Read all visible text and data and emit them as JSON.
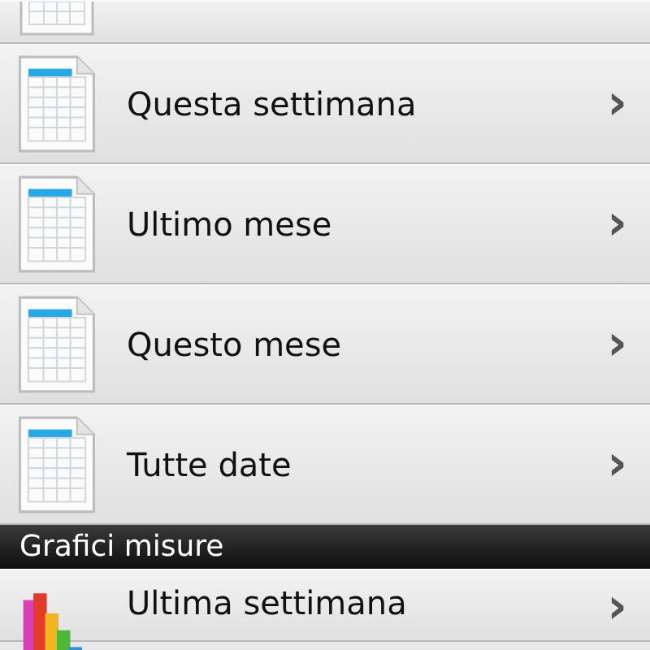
{
  "sections": [
    {
      "items": [
        {
          "kind": "sheet"
        },
        {
          "kind": "sheet",
          "label": "Questa settimana",
          "chevron": "›"
        },
        {
          "kind": "sheet",
          "label": "Ultimo mese",
          "chevron": "›"
        },
        {
          "kind": "sheet",
          "label": "Questo mese",
          "chevron": "›"
        },
        {
          "kind": "sheet",
          "label": "Tutte date",
          "chevron": "›"
        }
      ]
    },
    {
      "header": "Grafici misure",
      "items": [
        {
          "kind": "chart",
          "label": "Ultima settimana",
          "chevron": "›"
        }
      ]
    }
  ]
}
